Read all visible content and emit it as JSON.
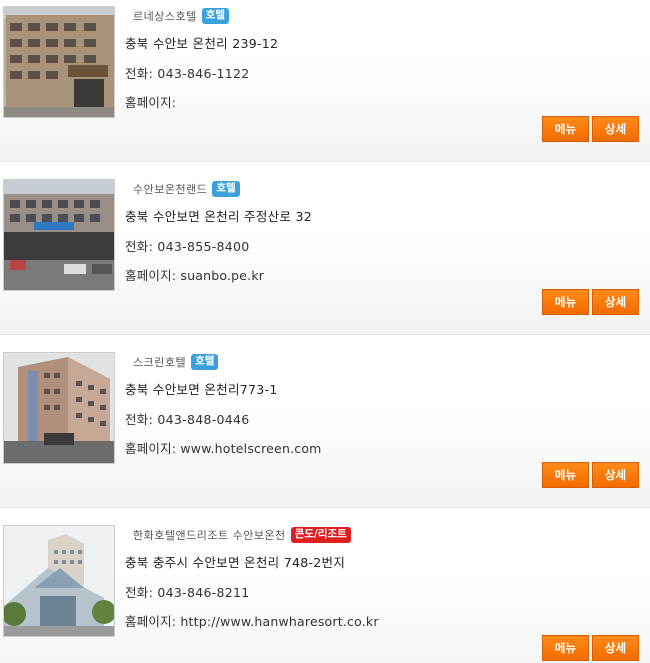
{
  "listings": [
    {
      "name": "르네상스호텔",
      "badge": "호텔",
      "address": "충북 수안보 온천리 239-12",
      "phone": "전화: 043-846-1122",
      "homepage": "홈페이지:",
      "menu_label": "메뉴",
      "detail_label": "상세"
    },
    {
      "name": "수안보온천랜드",
      "badge": "호텔",
      "address": "충북 수안보면 온천리 주정산로 32",
      "phone": "전화: 043-855-8400",
      "homepage": "홈페이지: suanbo.pe.kr",
      "menu_label": "메뉴",
      "detail_label": "상세"
    },
    {
      "name": "스크린호텔",
      "badge": "호텔",
      "address": "충북 수안보면 온천리773-1",
      "phone": "전화: 043-848-0446",
      "homepage": "홈페이지: www.hotelscreen.com",
      "menu_label": "메뉴",
      "detail_label": "상세"
    },
    {
      "name": "한화호텔앤드리조트 수안보온천",
      "badge": "콘도/리조트",
      "address": "충북 충주시 수안보면 온천리 748-2번지",
      "phone": "전화: 043-846-8211",
      "homepage": "홈페이지: http://www.hanwharesort.co.kr",
      "menu_label": "메뉴",
      "detail_label": "상세"
    }
  ],
  "colors": {
    "hotel_badge": "#3aa1dc",
    "condo_badge": "#e02020",
    "button": "#f57a0a"
  }
}
